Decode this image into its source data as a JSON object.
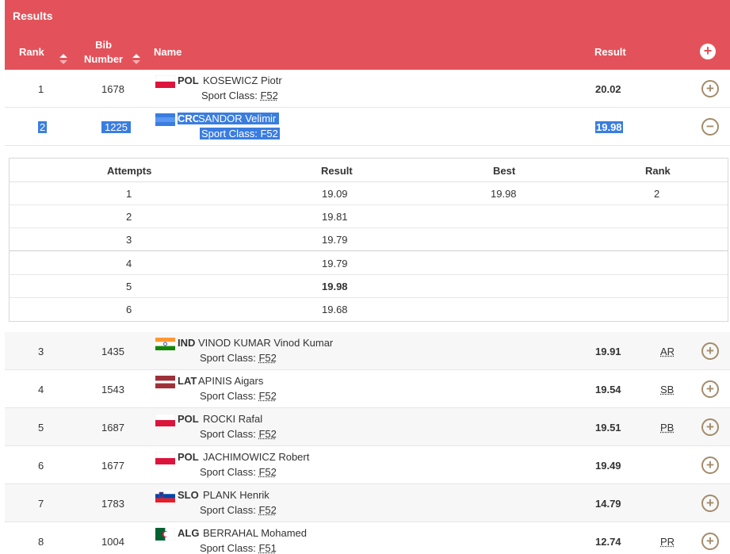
{
  "header": {
    "title": "Results",
    "col_rank": "Rank",
    "col_bib_line1": "Bib",
    "col_bib_line2": "Number",
    "col_name": "Name",
    "col_result": "Result",
    "bg_color": "#e3525a"
  },
  "rows_top": [
    {
      "rank": "1",
      "bib": "1678",
      "noc": "POL",
      "name": "KOSEWICZ Piotr",
      "class_label": "Sport Class:",
      "class_code": "F52",
      "result": "20.02",
      "record": "",
      "flag": "pol-flag",
      "toggle": "expand-icon"
    },
    {
      "rank": "2",
      "bib": "1225",
      "noc": "CRO",
      "name": "SANDOR Velimir",
      "class_label": "Sport Class:",
      "class_code": "F52",
      "result": "19.98",
      "record": "",
      "flag": "cro-flag",
      "toggle": "collapse-icon"
    }
  ],
  "attempts": {
    "headers": {
      "attempts": "Attempts",
      "result": "Result",
      "best": "Best",
      "rank": "Rank"
    },
    "rows": [
      {
        "n": "1",
        "result": "19.09",
        "best": "19.98",
        "rank": "2"
      },
      {
        "n": "2",
        "result": "19.81",
        "best": "",
        "rank": ""
      },
      {
        "n": "3",
        "result": "19.79",
        "best": "",
        "rank": ""
      },
      {
        "n": "4",
        "result": "19.79",
        "best": "",
        "rank": ""
      },
      {
        "n": "5",
        "result": "19.98",
        "best": "",
        "rank": ""
      },
      {
        "n": "6",
        "result": "19.68",
        "best": "",
        "rank": ""
      }
    ]
  },
  "rows_bottom": [
    {
      "rank": "3",
      "bib": "1435",
      "noc": "IND",
      "name": "VINOD KUMAR Vinod Kumar",
      "class_label": "Sport Class:",
      "class_code": "F52",
      "result": "19.91",
      "record": "AR",
      "flag": "ind-flag"
    },
    {
      "rank": "4",
      "bib": "1543",
      "noc": "LAT",
      "name": "APINIS Aigars",
      "class_label": "Sport Class:",
      "class_code": "F52",
      "result": "19.54",
      "record": "SB",
      "flag": "lat-flag"
    },
    {
      "rank": "5",
      "bib": "1687",
      "noc": "POL",
      "name": "ROCKI Rafal",
      "class_label": "Sport Class:",
      "class_code": "F52",
      "result": "19.51",
      "record": "PB",
      "flag": "pol-flag"
    },
    {
      "rank": "6",
      "bib": "1677",
      "noc": "POL",
      "name": "JACHIMOWICZ Robert",
      "class_label": "Sport Class:",
      "class_code": "F52",
      "result": "19.49",
      "record": "",
      "flag": "pol-flag"
    },
    {
      "rank": "7",
      "bib": "1783",
      "noc": "SLO",
      "name": "PLANK Henrik",
      "class_label": "Sport Class:",
      "class_code": "F52",
      "result": "14.79",
      "record": "",
      "flag": "slo-flag"
    },
    {
      "rank": "8",
      "bib": "1004",
      "noc": "ALG",
      "name": "BERRAHAL Mohamed",
      "class_label": "Sport Class:",
      "class_code": "F51",
      "result": "12.74",
      "record": "PR",
      "flag": "alg-flag"
    }
  ],
  "colors": {
    "accent": "#e3525a",
    "toggle": "#a38c6a",
    "selection": "#3a7de0"
  }
}
